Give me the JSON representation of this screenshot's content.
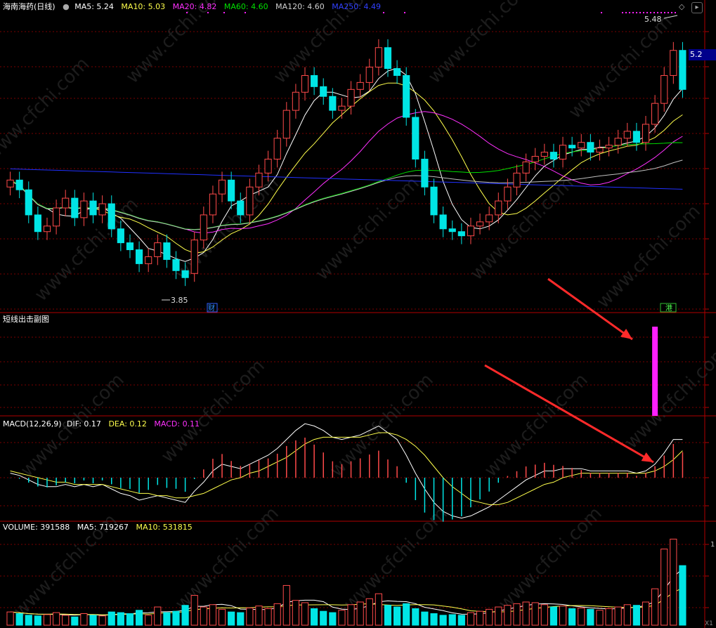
{
  "main_header": {
    "stock": "海南海药(日线)",
    "ma5": "MA5: 5.24",
    "ma10": "MA10: 5.03",
    "ma20": "MA20: 4.82",
    "ma60": "MA60: 4.60",
    "ma120": "MA120: 4.60",
    "ma250": "MA250: 4.49"
  },
  "price_labels": {
    "high": "5.48",
    "low": "3.85",
    "current": "5.2"
  },
  "event_markers": {
    "cai": "财",
    "gang": "港"
  },
  "sub_panel": {
    "title": "短线出击副图"
  },
  "macd_header": {
    "name": "MACD(12,26,9)",
    "dif": "DIF: 0.17",
    "dea": "DEA: 0.12",
    "macd": "MACD: 0.11"
  },
  "volume_header": {
    "name": "VOLUME: 391588",
    "ma5": "MA5: 719267",
    "ma10": "MA10: 531815"
  },
  "right_axis_tick": "1",
  "corner_label": "X1",
  "watermark": "www.cfchi.com",
  "colors": {
    "up": "#ff4a4a",
    "down": "#00e5e5",
    "ma5": "#ffffff",
    "ma10": "#ffff4c",
    "ma20": "#ff30ff",
    "ma60": "#00e000",
    "ma120": "#c0c0c0",
    "ma250": "#2030ff",
    "signal_bar": "#ff20ff",
    "arrow": "#ff2a2a",
    "grid": "#7a0000"
  },
  "chart_data": {
    "type": "candlestick",
    "closes": [
      4.55,
      4.48,
      4.3,
      4.18,
      4.22,
      4.35,
      4.42,
      4.28,
      4.4,
      4.3,
      4.38,
      4.2,
      4.1,
      4.05,
      3.95,
      4.0,
      4.1,
      3.98,
      3.9,
      3.85,
      4.12,
      4.3,
      4.45,
      4.55,
      4.4,
      4.3,
      4.5,
      4.6,
      4.7,
      4.85,
      5.05,
      5.18,
      5.3,
      5.22,
      5.15,
      5.05,
      5.08,
      5.2,
      5.25,
      5.36,
      5.5,
      5.35,
      5.3,
      5.0,
      4.7,
      4.5,
      4.3,
      4.2,
      4.18,
      4.15,
      4.22,
      4.25,
      4.3,
      4.4,
      4.5,
      4.6,
      4.68,
      4.72,
      4.75,
      4.7,
      4.8,
      4.78,
      4.82,
      4.75,
      4.78,
      4.8,
      4.85,
      4.9,
      4.82,
      4.95,
      5.1,
      5.3,
      5.48,
      5.2
    ],
    "opens": [
      4.5,
      4.55,
      4.48,
      4.3,
      4.18,
      4.22,
      4.35,
      4.42,
      4.28,
      4.4,
      4.3,
      4.38,
      4.2,
      4.1,
      4.05,
      3.95,
      4.0,
      4.1,
      3.98,
      3.9,
      3.88,
      4.12,
      4.3,
      4.45,
      4.55,
      4.4,
      4.3,
      4.5,
      4.6,
      4.7,
      4.85,
      5.05,
      5.18,
      5.3,
      5.22,
      5.15,
      5.05,
      5.08,
      5.2,
      5.25,
      5.36,
      5.5,
      5.35,
      5.3,
      5.0,
      4.7,
      4.5,
      4.3,
      4.2,
      4.18,
      4.15,
      4.22,
      4.25,
      4.3,
      4.4,
      4.5,
      4.6,
      4.68,
      4.72,
      4.75,
      4.7,
      4.8,
      4.78,
      4.82,
      4.75,
      4.78,
      4.8,
      4.85,
      4.9,
      4.82,
      4.95,
      5.1,
      5.3,
      5.48
    ],
    "ma250_level": 4.49,
    "y_range": [
      3.7,
      5.65
    ],
    "macd_dif": [
      0.02,
      0.01,
      -0.01,
      -0.03,
      -0.04,
      -0.04,
      -0.03,
      -0.04,
      -0.03,
      -0.04,
      -0.03,
      -0.05,
      -0.07,
      -0.08,
      -0.1,
      -0.09,
      -0.08,
      -0.09,
      -0.1,
      -0.11,
      -0.06,
      -0.02,
      0.03,
      0.06,
      0.05,
      0.04,
      0.06,
      0.08,
      0.1,
      0.13,
      0.17,
      0.21,
      0.24,
      0.23,
      0.21,
      0.18,
      0.17,
      0.18,
      0.19,
      0.21,
      0.23,
      0.2,
      0.17,
      0.1,
      0.02,
      -0.05,
      -0.11,
      -0.15,
      -0.17,
      -0.18,
      -0.17,
      -0.15,
      -0.13,
      -0.1,
      -0.07,
      -0.04,
      -0.01,
      0.01,
      0.03,
      0.03,
      0.04,
      0.04,
      0.04,
      0.03,
      0.03,
      0.03,
      0.03,
      0.03,
      0.02,
      0.03,
      0.06,
      0.11,
      0.17,
      0.17
    ],
    "macd_dea": [
      0.03,
      0.02,
      0.01,
      0.0,
      -0.01,
      -0.02,
      -0.02,
      -0.03,
      -0.03,
      -0.03,
      -0.03,
      -0.04,
      -0.05,
      -0.06,
      -0.07,
      -0.07,
      -0.08,
      -0.08,
      -0.09,
      -0.09,
      -0.08,
      -0.07,
      -0.05,
      -0.03,
      -0.01,
      0.0,
      0.02,
      0.03,
      0.05,
      0.07,
      0.09,
      0.12,
      0.15,
      0.17,
      0.18,
      0.18,
      0.18,
      0.18,
      0.18,
      0.19,
      0.2,
      0.2,
      0.19,
      0.17,
      0.14,
      0.1,
      0.05,
      0.0,
      -0.04,
      -0.07,
      -0.1,
      -0.11,
      -0.12,
      -0.12,
      -0.11,
      -0.09,
      -0.07,
      -0.05,
      -0.03,
      -0.02,
      0.0,
      0.01,
      0.02,
      0.02,
      0.02,
      0.02,
      0.02,
      0.02,
      0.02,
      0.02,
      0.03,
      0.05,
      0.08,
      0.12
    ],
    "volume": [
      40,
      35,
      30,
      28,
      32,
      38,
      30,
      25,
      35,
      30,
      28,
      40,
      38,
      35,
      45,
      30,
      55,
      38,
      42,
      60,
      90,
      55,
      62,
      48,
      40,
      38,
      52,
      58,
      50,
      65,
      120,
      75,
      68,
      50,
      42,
      38,
      45,
      62,
      70,
      80,
      95,
      60,
      55,
      65,
      50,
      40,
      35,
      30,
      32,
      30,
      38,
      42,
      48,
      55,
      60,
      65,
      70,
      68,
      62,
      55,
      58,
      50,
      52,
      48,
      45,
      50,
      55,
      62,
      60,
      70,
      110,
      230,
      260,
      180
    ],
    "signal_index": 70
  }
}
